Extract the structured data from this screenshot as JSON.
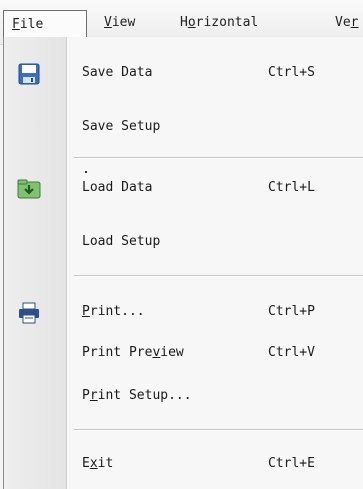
{
  "menubar": {
    "items": [
      {
        "prefix": "",
        "accel": "F",
        "suffix": "ile"
      },
      {
        "prefix": "",
        "accel": "V",
        "suffix": "iew"
      },
      {
        "prefix": "H",
        "accel": "o",
        "suffix": "rizontal"
      },
      {
        "prefix": "Ve",
        "accel": "r",
        "suffix": ""
      }
    ]
  },
  "file_menu": {
    "save_data": {
      "label": "Save Data",
      "shortcut": "Ctrl+S",
      "icon": "save-icon"
    },
    "save_setup": {
      "label": "Save Setup"
    },
    "load_data": {
      "label": "Load Data",
      "shortcut": "Ctrl+L",
      "icon": "load-icon"
    },
    "load_setup": {
      "label": "Load Setup"
    },
    "print": {
      "prefix": "",
      "accel": "P",
      "suffix": "rint...",
      "shortcut": "Ctrl+P",
      "icon": "printer-icon"
    },
    "print_preview": {
      "prefix": "Print Pre",
      "accel": "v",
      "suffix": "iew",
      "shortcut": "Ctrl+V"
    },
    "print_setup": {
      "prefix": "P",
      "accel": "r",
      "suffix": "int Setup..."
    },
    "exit": {
      "prefix": "E",
      "accel": "x",
      "suffix": "it",
      "shortcut": "Ctrl+E"
    }
  },
  "colors": {
    "save_icon": "#3a6fc0",
    "load_icon": "#3d9a3d",
    "printer_icon": "#2d4f8a"
  }
}
